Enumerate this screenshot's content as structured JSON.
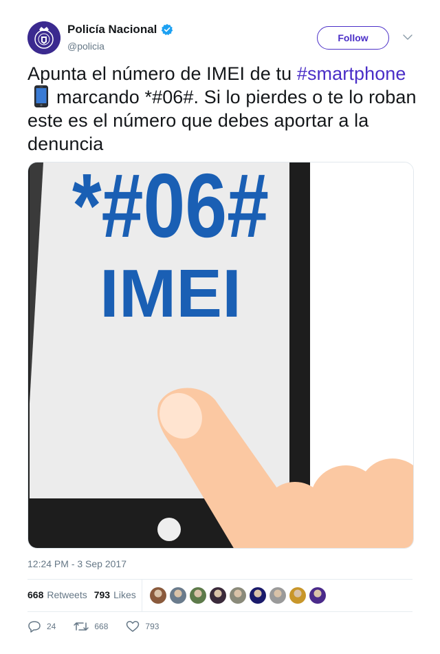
{
  "author": {
    "display_name": "Policía Nacional",
    "handle": "@policia",
    "verified": true,
    "avatar_icon": "policia-emblem-icon",
    "avatar_color": "#3b2a8f"
  },
  "follow_label": "Follow",
  "tweet": {
    "text_part1": "Apunta el número de IMEI de tu ",
    "hashtag": "#smartphone",
    "emoji_icon": "mobile-phone-icon",
    "text_part2": "marcando *#06#. Si lo pierdes o te lo roban este es el número que debes aportar a la denuncia"
  },
  "media": {
    "code": "*#06#",
    "caption": "IMEI"
  },
  "timestamp": "12:24 PM - 3 Sep 2017",
  "stats": {
    "retweets_count": "668",
    "retweets_label": "Retweets",
    "likes_count": "793",
    "likes_label": "Likes"
  },
  "likers": [
    {
      "color": "#8a5a3c"
    },
    {
      "color": "#6a7b8c"
    },
    {
      "color": "#5d7a4a"
    },
    {
      "color": "#3a2a3a"
    },
    {
      "color": "#8a8a7a"
    },
    {
      "color": "#1a1a6a"
    },
    {
      "color": "#9a9a9a"
    },
    {
      "color": "#c8962a"
    },
    {
      "color": "#4a2a8a"
    }
  ],
  "actions": {
    "replies": "24",
    "retweets": "668",
    "likes": "793"
  },
  "colors": {
    "accent": "#4a2ec7",
    "muted": "#657786",
    "verified_blue": "#1da1f2",
    "imei_blue": "#1a5fb4",
    "finger": "#fbc8a2"
  }
}
